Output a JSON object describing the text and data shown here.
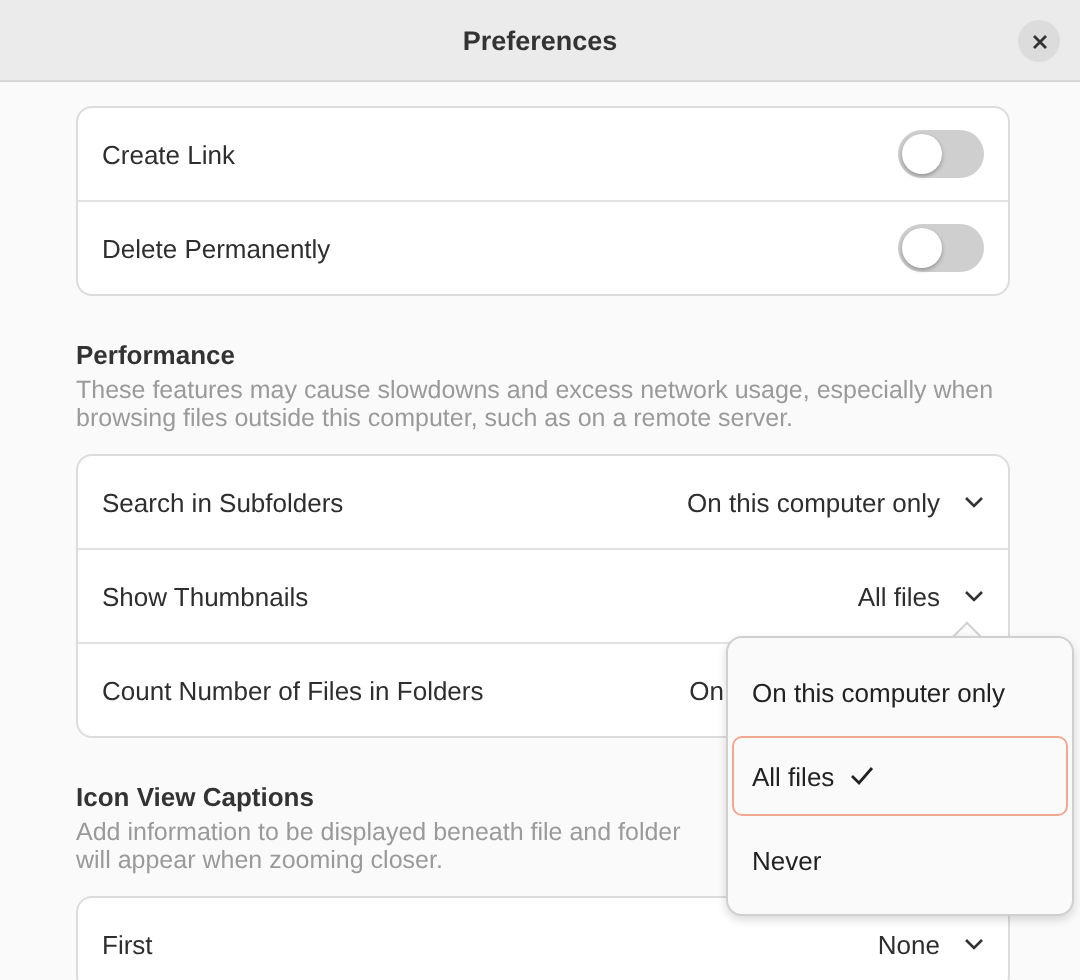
{
  "window": {
    "title": "Preferences"
  },
  "groups": [
    {
      "rows": [
        {
          "kind": "switch",
          "label": "Create Link",
          "on": false
        },
        {
          "kind": "switch",
          "label": "Delete Permanently",
          "on": false
        }
      ]
    },
    {
      "title": "Performance",
      "description": [
        "These features may cause slowdowns and excess network usage, especially when",
        "browsing files outside this computer, such as on a remote server."
      ],
      "rows": [
        {
          "kind": "dropdown",
          "label": "Search in Subfolders",
          "value": "On this computer only"
        },
        {
          "kind": "dropdown",
          "label": "Show Thumbnails",
          "value": "All files"
        },
        {
          "kind": "dropdown",
          "label": "Count Number of Files in Folders",
          "value": "On",
          "covered": true
        }
      ]
    },
    {
      "title": "Icon View Captions",
      "description": [
        "Add information to be displayed beneath file and folder",
        "will appear when zooming closer."
      ],
      "rows": [
        {
          "kind": "dropdown",
          "label": "First",
          "value": "None"
        }
      ]
    }
  ],
  "popover": {
    "items": [
      {
        "label": "On this computer only",
        "selected": false
      },
      {
        "label": "All files",
        "selected": true
      },
      {
        "label": "Never",
        "selected": false
      }
    ]
  }
}
